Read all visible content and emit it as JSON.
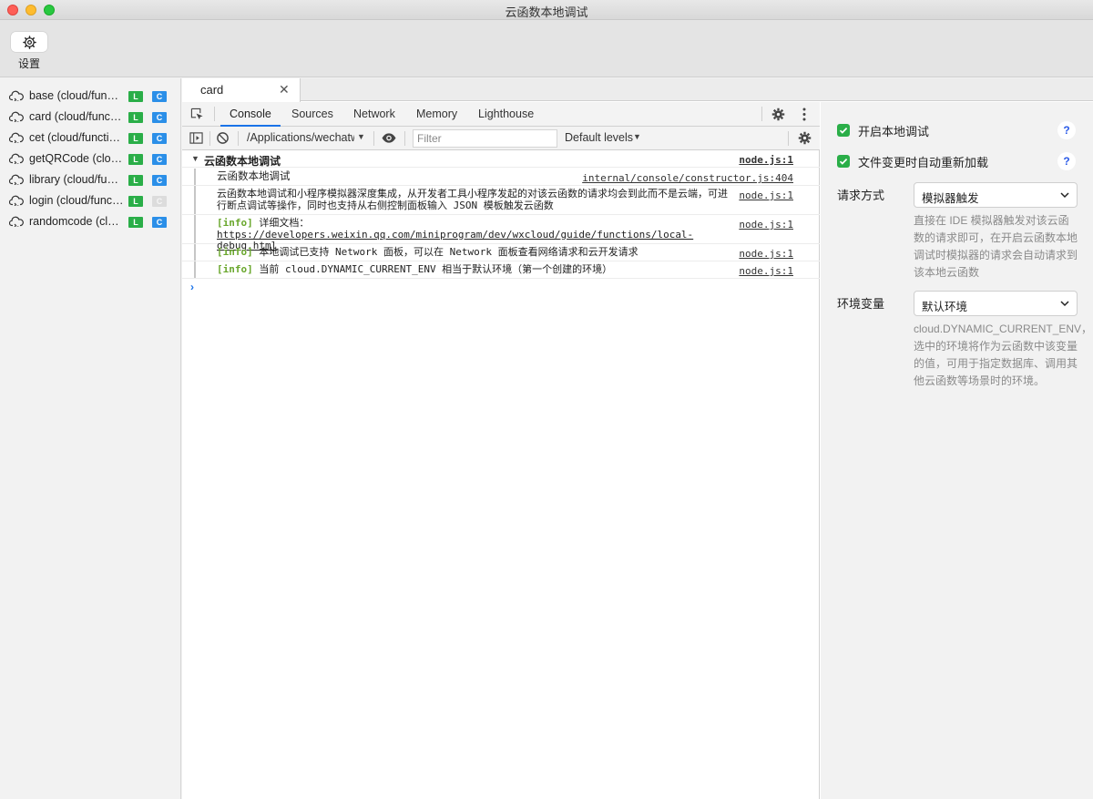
{
  "window": {
    "title": "云函数本地调试"
  },
  "toolbar": {
    "settings_label": "设置"
  },
  "functions": [
    {
      "name": "base (cloud/func…",
      "local_badge": "L",
      "cloud_badge": "C",
      "cloud_enabled": true
    },
    {
      "name": "card (cloud/func…",
      "local_badge": "L",
      "cloud_badge": "C",
      "cloud_enabled": true
    },
    {
      "name": "cet (cloud/functi…",
      "local_badge": "L",
      "cloud_badge": "C",
      "cloud_enabled": true
    },
    {
      "name": "getQRCode (clo…",
      "local_badge": "L",
      "cloud_badge": "C",
      "cloud_enabled": true
    },
    {
      "name": "library (cloud/fun…",
      "local_badge": "L",
      "cloud_badge": "C",
      "cloud_enabled": true
    },
    {
      "name": "login (cloud/func…",
      "local_badge": "L",
      "cloud_badge": "C",
      "cloud_enabled": false
    },
    {
      "name": "randomcode (clo…",
      "local_badge": "L",
      "cloud_badge": "C",
      "cloud_enabled": true
    }
  ],
  "file_tab": {
    "label": "card",
    "close": "✕"
  },
  "devtools": {
    "tabs": [
      "Console",
      "Sources",
      "Network",
      "Memory",
      "Lighthouse"
    ],
    "active_tab": "Console",
    "context": "/Applications/wechatwebdevtools.app",
    "filter_placeholder": "Filter",
    "levels": "Default levels"
  },
  "console": {
    "group_title": "云函数本地调试",
    "group_source": "node.js:1",
    "rows": [
      {
        "tag": "",
        "text": "云函数本地调试",
        "link": "",
        "source": "internal/console/constructor.js:404"
      },
      {
        "tag": "",
        "text": "云函数本地调试和小程序模拟器深度集成，从开发者工具小程序发起的对该云函数的请求均会到此而不是云端，可进行断点调试等操作，同时也支持从右侧控制面板输入 JSON 模板触发云函数",
        "link": "",
        "source": "node.js:1"
      },
      {
        "tag": "[info]",
        "text": "详细文档：",
        "link": "https://developers.weixin.qq.com/miniprogram/dev/wxcloud/guide/functions/local-debug.html",
        "source": "node.js:1"
      },
      {
        "tag": "[info]",
        "text": "本地调试已支持 Network 面板，可以在 Network 面板查看网络请求和云开发请求",
        "link": "",
        "source": "node.js:1"
      },
      {
        "tag": "[info]",
        "text": "当前 cloud.DYNAMIC_CURRENT_ENV 相当于默认环境（第一个创建的环境）",
        "link": "",
        "source": "node.js:1"
      }
    ],
    "prompt": "›"
  },
  "settings": {
    "enable_local": {
      "label": "开启本地调试",
      "checked": true
    },
    "auto_reload": {
      "label": "文件变更时自动重新加载",
      "checked": true
    },
    "help": "?",
    "request_mode": {
      "label": "请求方式",
      "value": "模拟器触发",
      "description": "直接在 IDE 模拟器触发对该云函数的请求即可，在开启云函数本地调试时模拟器的请求会自动请求到该本地云函数"
    },
    "env_var": {
      "label": "环境变量",
      "value": "默认环境",
      "description": "cloud.DYNAMIC_CURRENT_ENV，选中的环境将作为云函数中该变量的值，可用于指定数据库、调用其他云函数等场景时的环境。"
    }
  },
  "colors": {
    "local_badge": "#2aae48",
    "cloud_badge": "#2b8fe8",
    "checkbox": "#2aae48",
    "info_tag": "#6aa72d",
    "active_tab": "#1a73e8"
  }
}
